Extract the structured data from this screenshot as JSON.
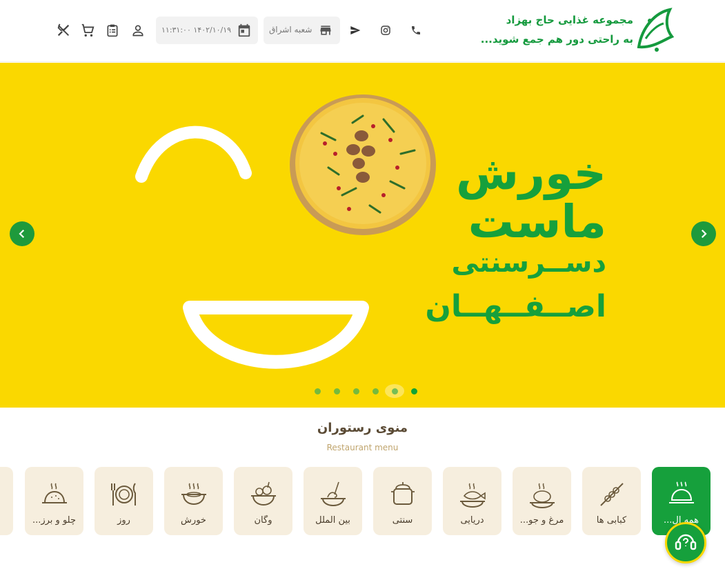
{
  "header": {
    "logo_line1": "مجموعه غذایی حاج بهزاد",
    "logo_line2": "به راحتی دور هم جمع شوید...",
    "branch_label": "شعبه اشراق",
    "datetime_label": "۱۴۰۲/۱۰/۱۹ ۱۱:۳۱:۰۰",
    "icons": [
      "phone-icon",
      "instagram-icon",
      "send-icon",
      "store-icon",
      "calendar-icon",
      "person-icon",
      "clipboard-icon",
      "cart-icon",
      "restaurant-icon"
    ]
  },
  "hero": {
    "line1": "خورش",
    "line2": "ماست",
    "line3": "دســرسنتی",
    "line4": "اصــفــهــان",
    "slides_count": 6,
    "active_slide": 6
  },
  "menu": {
    "title": "منوی رستوران",
    "subtitle": "Restaurant menu",
    "categories": [
      {
        "label": "همه ال...",
        "icon": "cloche-icon",
        "active": true
      },
      {
        "label": "کبابی ها",
        "icon": "kebab-icon",
        "active": false
      },
      {
        "label": "مرغ و جو...",
        "icon": "chicken-icon",
        "active": false
      },
      {
        "label": "دریایی",
        "icon": "fish-icon",
        "active": false
      },
      {
        "label": "سنتی",
        "icon": "pot-icon",
        "active": false
      },
      {
        "label": "بین الملل",
        "icon": "pasta-icon",
        "active": false
      },
      {
        "label": "وگان",
        "icon": "salad-icon",
        "active": false
      },
      {
        "label": "خورش",
        "icon": "stew-icon",
        "active": false
      },
      {
        "label": "روز",
        "icon": "plate-icon",
        "active": false
      },
      {
        "label": "چلو و برز...",
        "icon": "rice-icon",
        "active": false
      }
    ]
  },
  "colors": {
    "brand_green": "#16a03c",
    "hero_yellow": "#fad800",
    "card_beige": "#f6eede"
  }
}
